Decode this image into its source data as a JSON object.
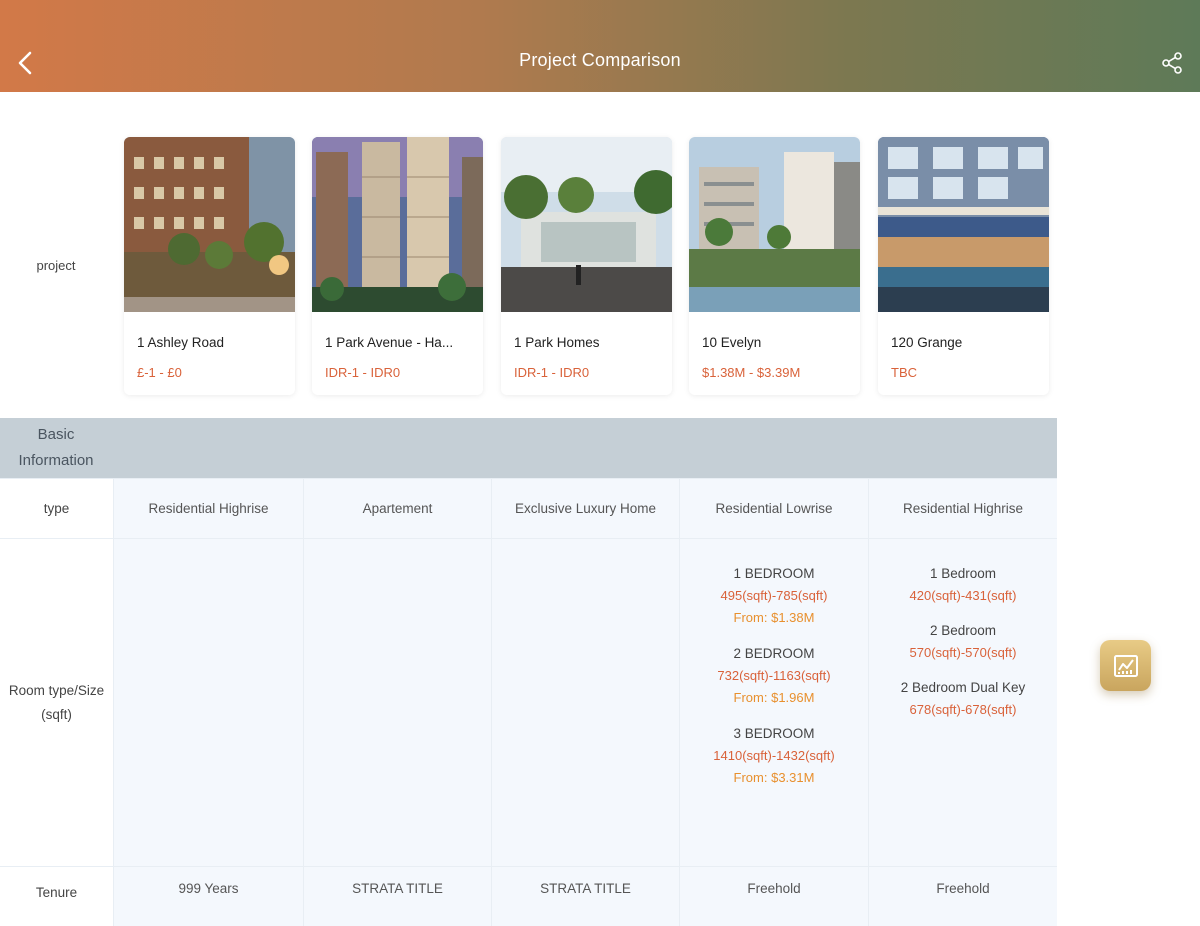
{
  "header": {
    "title": "Project Comparison"
  },
  "project_label": "project",
  "projects": [
    {
      "name": "1 Ashley Road",
      "price": "£-1 - £0"
    },
    {
      "name": "1 Park Avenue - Ha...",
      "price": "IDR-1 - IDR0"
    },
    {
      "name": "1 Park Homes",
      "price": "IDR-1 - IDR0"
    },
    {
      "name": "10 Evelyn",
      "price": "$1.38M - $3.39M"
    },
    {
      "name": "120 Grange",
      "price": "TBC"
    }
  ],
  "section": {
    "label": "Basic Information"
  },
  "rows": {
    "type": {
      "label": "type",
      "values": [
        "Residential Highrise",
        "Apartement",
        "Exclusive Luxury Home",
        "Residential Lowrise",
        "Residential Highrise"
      ]
    },
    "room": {
      "label": "Room type/Size (sqft)",
      "evelyn": [
        {
          "type": "1 BEDROOM",
          "size": "495(sqft)-785(sqft)",
          "from": "From: $1.38M"
        },
        {
          "type": "2 BEDROOM",
          "size": "732(sqft)-1163(sqft)",
          "from": "From: $1.96M"
        },
        {
          "type": "3 BEDROOM",
          "size": "1410(sqft)-1432(sqft)",
          "from": "From: $3.31M"
        }
      ],
      "grange": [
        {
          "type": "1 Bedroom",
          "size": "420(sqft)-431(sqft)"
        },
        {
          "type": "2 Bedroom",
          "size": "570(sqft)-570(sqft)"
        },
        {
          "type": "2 Bedroom Dual Key",
          "size": "678(sqft)-678(sqft)"
        }
      ]
    },
    "tenure": {
      "label": "Tenure",
      "values": [
        "999 Years",
        "STRATA TITLE",
        "STRATA TITLE",
        "Freehold",
        "Freehold"
      ]
    }
  },
  "colors": {
    "accent": "#d9623a",
    "from": "#e8902e",
    "band": "#c5cfd6",
    "cell": "#f4f8fd"
  },
  "icons": {
    "back": "chevron-left-icon",
    "share": "share-icon",
    "fab": "chart-icon"
  }
}
